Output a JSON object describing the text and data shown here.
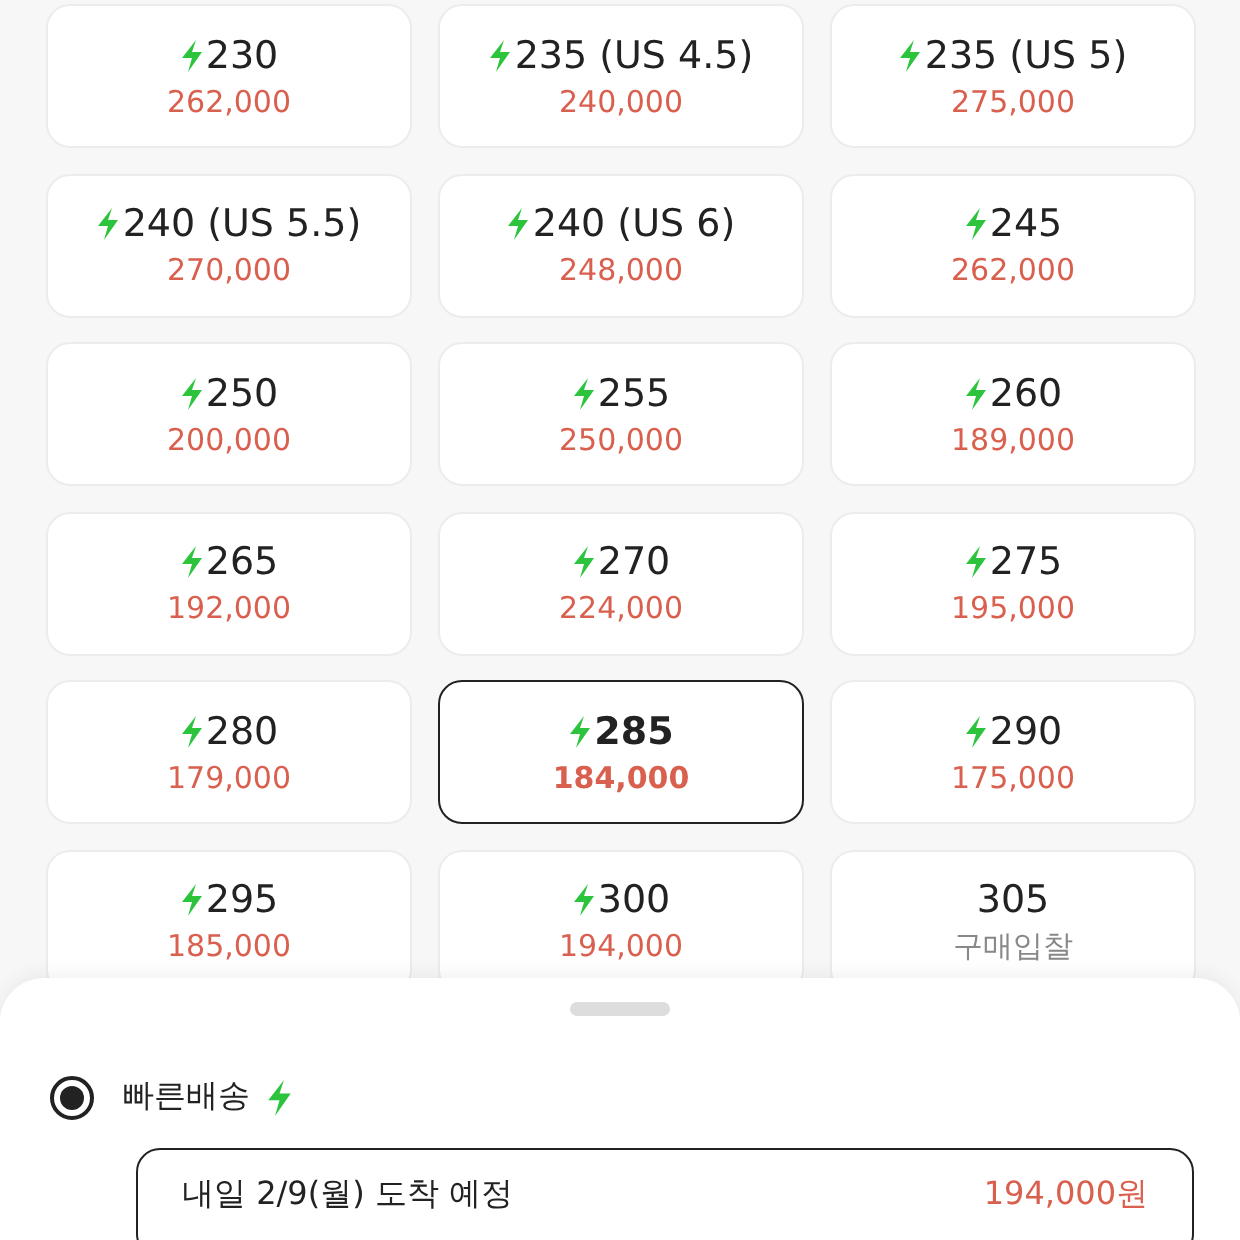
{
  "sizes": [
    {
      "size": "230",
      "price": "262,000",
      "fast": true,
      "selected": false
    },
    {
      "size": "235 (US 4.5)",
      "price": "240,000",
      "fast": true,
      "selected": false
    },
    {
      "size": "235 (US 5)",
      "price": "275,000",
      "fast": true,
      "selected": false
    },
    {
      "size": "240 (US 5.5)",
      "price": "270,000",
      "fast": true,
      "selected": false
    },
    {
      "size": "240 (US 6)",
      "price": "248,000",
      "fast": true,
      "selected": false
    },
    {
      "size": "245",
      "price": "262,000",
      "fast": true,
      "selected": false
    },
    {
      "size": "250",
      "price": "200,000",
      "fast": true,
      "selected": false
    },
    {
      "size": "255",
      "price": "250,000",
      "fast": true,
      "selected": false
    },
    {
      "size": "260",
      "price": "189,000",
      "fast": true,
      "selected": false
    },
    {
      "size": "265",
      "price": "192,000",
      "fast": true,
      "selected": false
    },
    {
      "size": "270",
      "price": "224,000",
      "fast": true,
      "selected": false
    },
    {
      "size": "275",
      "price": "195,000",
      "fast": true,
      "selected": false
    },
    {
      "size": "280",
      "price": "179,000",
      "fast": true,
      "selected": false
    },
    {
      "size": "285",
      "price": "184,000",
      "fast": true,
      "selected": true
    },
    {
      "size": "290",
      "price": "175,000",
      "fast": true,
      "selected": false
    },
    {
      "size": "295",
      "price": "185,000",
      "fast": true,
      "selected": false
    },
    {
      "size": "300",
      "price": "194,000",
      "fast": true,
      "selected": false
    },
    {
      "size": "305",
      "price": "구매입찰",
      "fast": false,
      "selected": false
    }
  ],
  "shipping": {
    "label": "빠른배송",
    "fast": true,
    "selected": true,
    "option": {
      "arrival": "내일 2/9(월) 도착 예정",
      "price": "194,000원",
      "selected": true
    }
  }
}
